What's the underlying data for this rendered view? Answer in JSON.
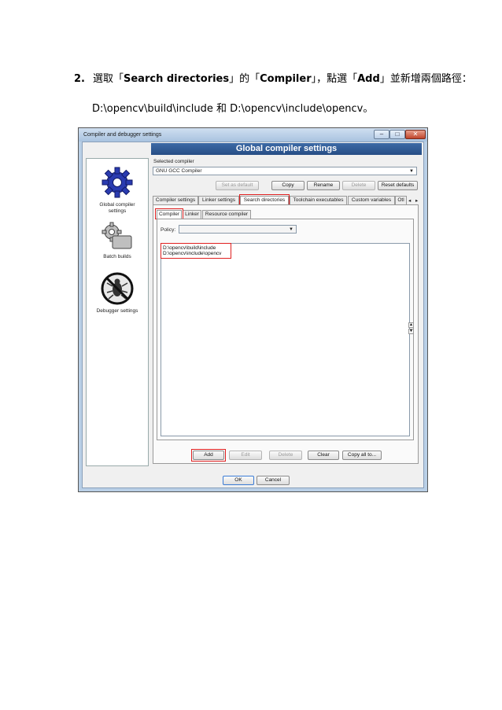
{
  "instruction": {
    "step_number": "2.",
    "text_select": "選取「",
    "search_directories": "Search directories",
    "text_of": "」的「",
    "compiler": "Compiler",
    "text_click": "」，點選「",
    "add": "Add",
    "text_end": "」並新增兩個路徑：",
    "paths_line": "D:\\opencv\\build\\include 和 D:\\opencv\\include\\opencv。"
  },
  "dialog": {
    "window_title": "Compiler and debugger settings",
    "header": "Global compiler settings",
    "sidebar": [
      {
        "label_1": "Global compiler",
        "label_2": "settings"
      },
      {
        "label_1": "Batch builds",
        "label_2": ""
      },
      {
        "label_1": "Debugger settings",
        "label_2": ""
      }
    ],
    "selected_compiler_label": "Selected compiler",
    "selected_compiler_value": "GNU GCC Compiler",
    "buttons": {
      "set_default": "Set as default",
      "copy": "Copy",
      "rename": "Rename",
      "delete": "Delete",
      "reset_defaults": "Reset defaults"
    },
    "tabs": [
      "Compiler settings",
      "Linker settings",
      "Search directories",
      "Toolchain executables",
      "Custom variables",
      "Otl"
    ],
    "subtabs": [
      "Compiler",
      "Linker",
      "Resource compiler"
    ],
    "policy_label": "Policy:",
    "directories": [
      "D:\\opencv\\build\\include",
      "D:\\opencv\\include\\opencv"
    ],
    "list_buttons": {
      "add": "Add",
      "edit": "Edit",
      "delete": "Delete",
      "clear": "Clear",
      "copy_all": "Copy all to..."
    },
    "ok": "OK",
    "cancel": "Cancel"
  },
  "colors": {
    "highlight": "#e02020",
    "header": "#2f5b96"
  }
}
